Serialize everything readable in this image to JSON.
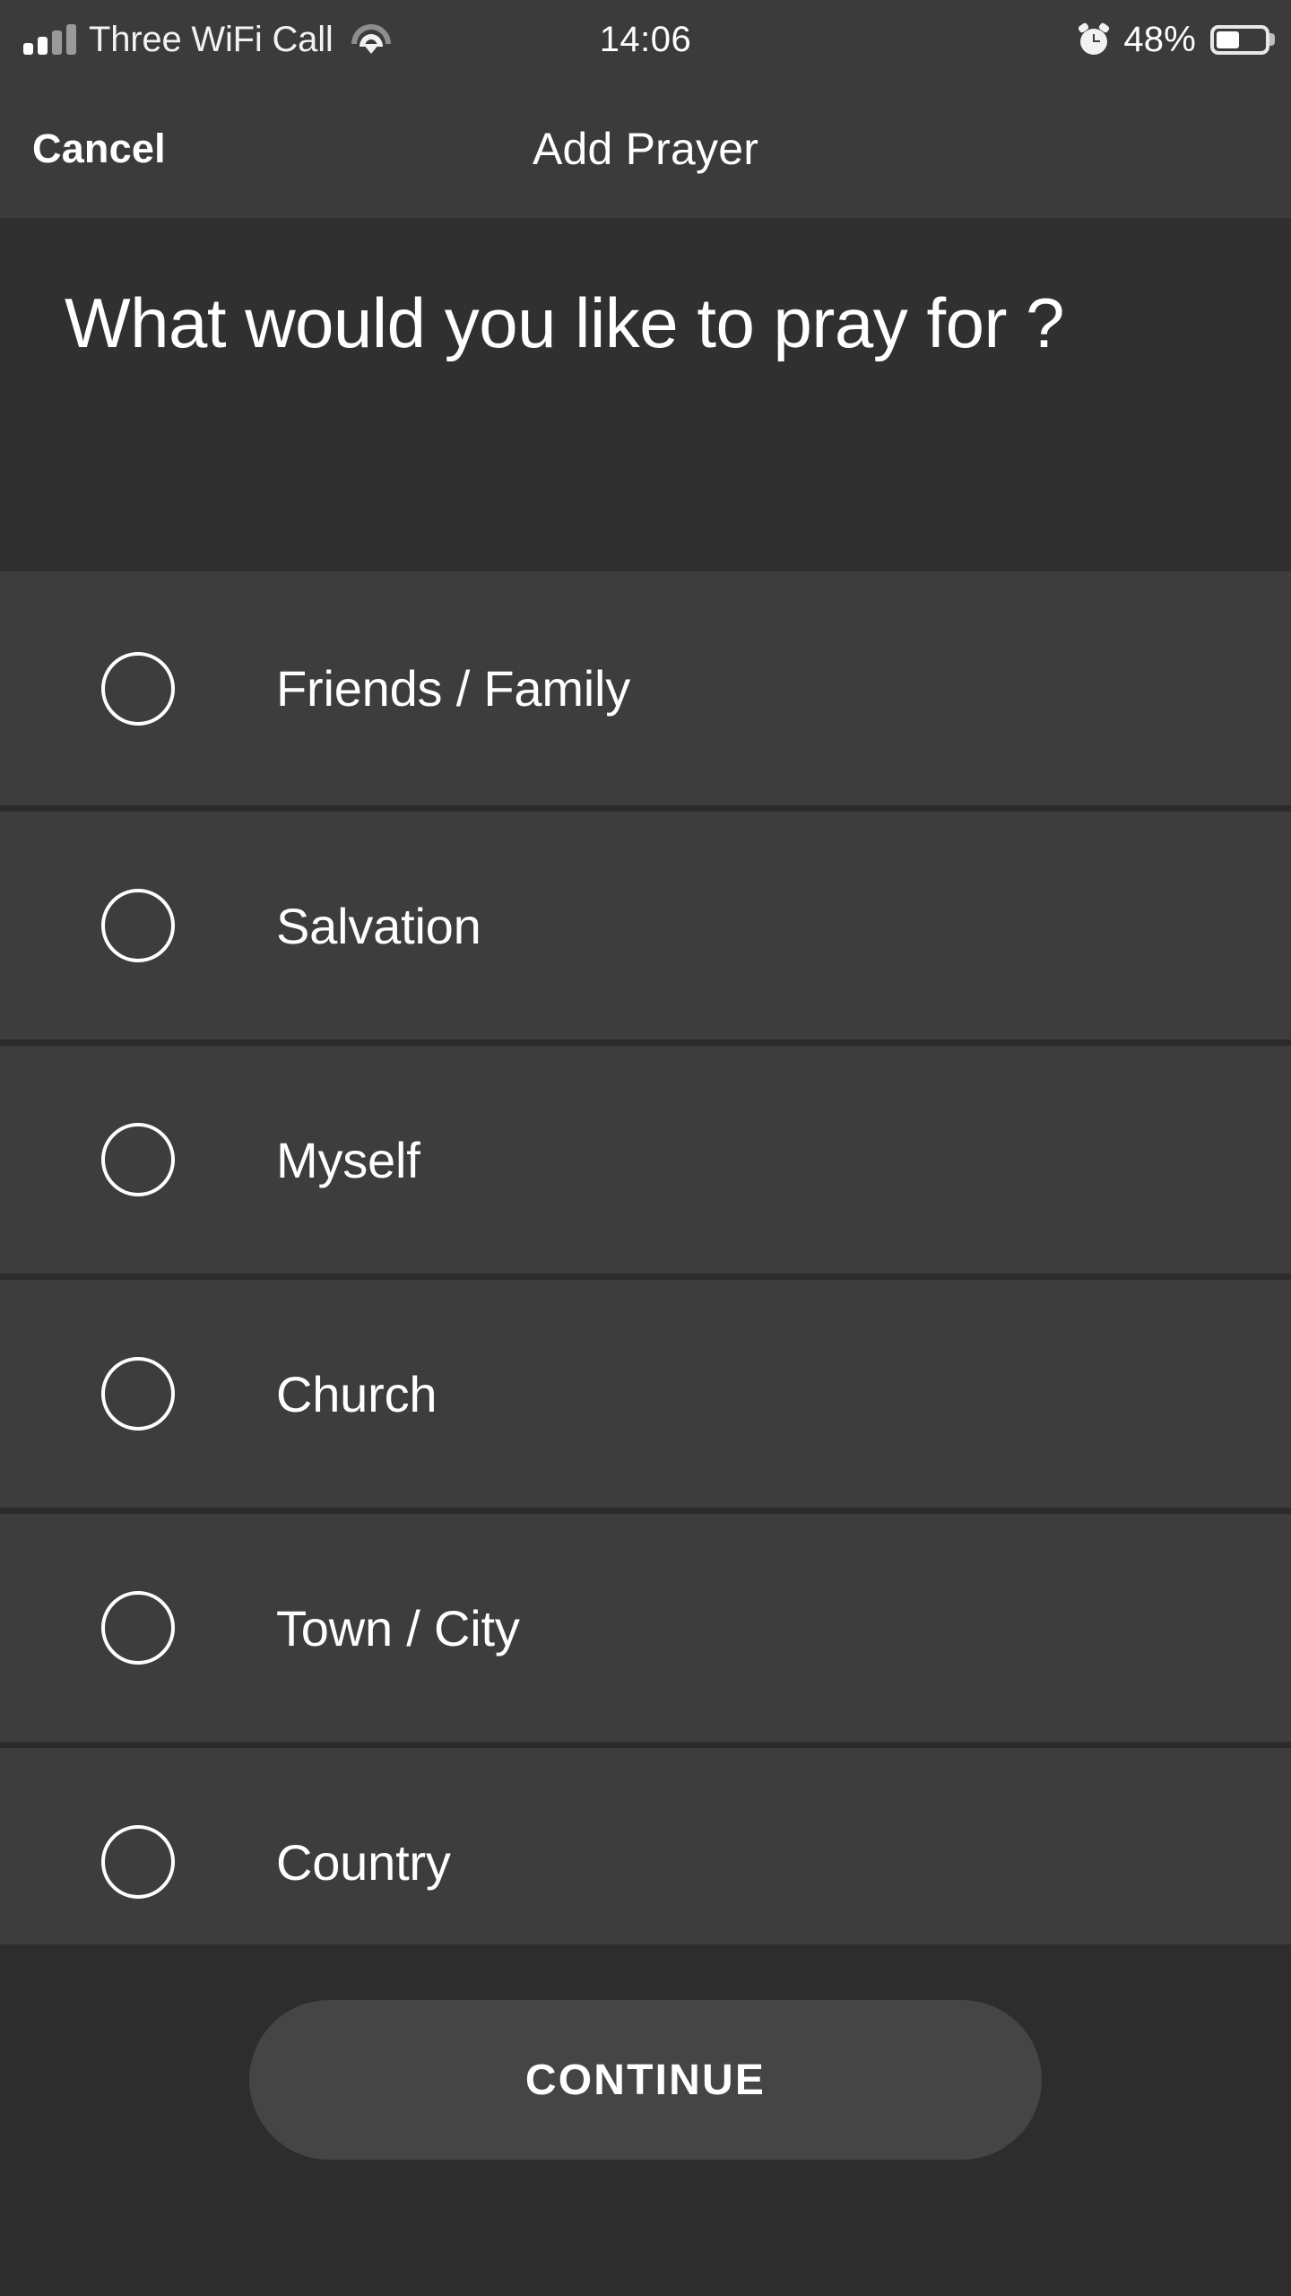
{
  "status_bar": {
    "carrier": "Three WiFi Call",
    "time": "14:06",
    "battery_percent": "48%",
    "battery_level": 48,
    "signal_icon": "signal-bars-icon",
    "wifi_icon": "wifi-icon",
    "alarm_icon": "alarm-clock-icon",
    "battery_icon": "battery-icon"
  },
  "nav_bar": {
    "cancel_label": "Cancel",
    "title": "Add Prayer"
  },
  "heading": {
    "text": "What would you like to pray for ?"
  },
  "options": [
    {
      "label": "Friends / Family",
      "selected": false
    },
    {
      "label": "Salvation",
      "selected": false
    },
    {
      "label": "Myself",
      "selected": false
    },
    {
      "label": "Church",
      "selected": false
    },
    {
      "label": "Town / City",
      "selected": false
    },
    {
      "label": "Country",
      "selected": false
    }
  ],
  "footer": {
    "continue_label": "CONTINUE"
  },
  "colors": {
    "page_background": "#2d2d2d",
    "status_bar_background": "#3b3b3b",
    "nav_bar_background": "#3b3b3b",
    "heading_background": "#303030",
    "row_background": "#3d3d3d",
    "row_divider": "#2b2b2b",
    "button_background": "#454545",
    "text_primary": "#ffffff"
  }
}
